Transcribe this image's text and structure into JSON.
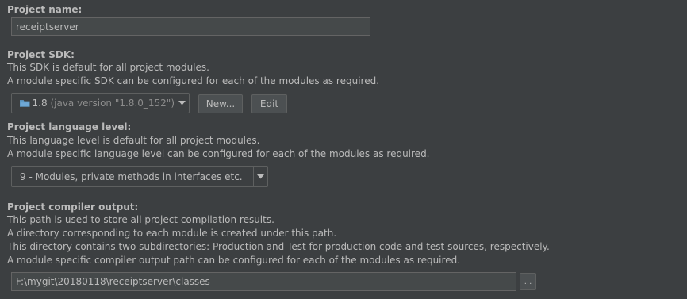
{
  "project_name": {
    "label": "Project name:",
    "value": "receiptserver"
  },
  "project_sdk": {
    "label": "Project SDK:",
    "desc_1": "This SDK is default for all project modules.",
    "desc_2": "A module specific SDK can be configured for each of the modules as required.",
    "selected_version": "1.8",
    "selected_detail": "(java version \"1.8.0_152\")",
    "icon": "folder-icon",
    "new_button": "New...",
    "edit_button": "Edit"
  },
  "language_level": {
    "label": "Project language level:",
    "desc_1": "This language level is default for all project modules.",
    "desc_2": "A module specific language level can be configured for each of the modules as required.",
    "selected": "9 - Modules, private methods in interfaces etc."
  },
  "compiler_output": {
    "label": "Project compiler output:",
    "desc_1": "This path is used to store all project compilation results.",
    "desc_2": "A directory corresponding to each module is created under this path.",
    "desc_3": "This directory contains two subdirectories: Production and Test for production code and test sources, respectively.",
    "desc_4": "A module specific compiler output path can be configured for each of the modules as required.",
    "path": "F:\\mygit\\20180118\\receiptserver\\classes",
    "browse_button": "..."
  },
  "colors": {
    "background": "#3c3f41",
    "text": "#bbbbbb",
    "field_background": "#45494a",
    "border": "#5e6060",
    "folder_icon": "#5e9ac6"
  }
}
